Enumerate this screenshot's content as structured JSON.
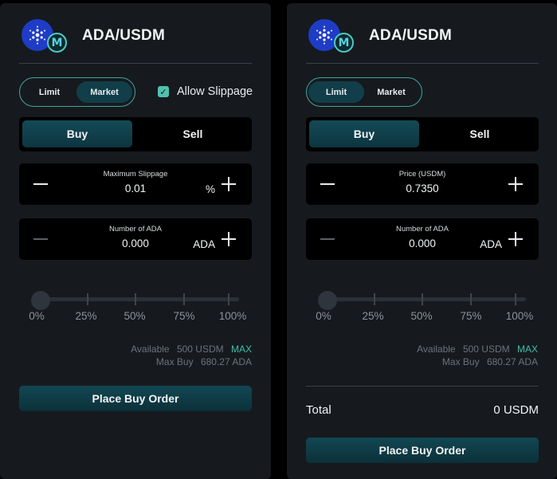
{
  "colors": {
    "accent": "#3dbfa7",
    "toggle_border": "#3ea59a",
    "buy_active": "#134a55",
    "ada_coin": "#1f3cc6"
  },
  "left_panel": {
    "header": {
      "pair": "ADA/USDM",
      "base_icon": "cardano-icon",
      "quote_icon": "usdm-icon",
      "quote_glyph": "M"
    },
    "order_type": {
      "limit_label": "Limit",
      "market_label": "Market",
      "selected": "Market"
    },
    "allow_slippage": {
      "label": "Allow Slippage",
      "checked": true,
      "check_glyph": "✓"
    },
    "side": {
      "buy_label": "Buy",
      "sell_label": "Sell",
      "selected": "Buy"
    },
    "field1": {
      "label": "Maximum Slippage",
      "value": "0.01",
      "unit": "%"
    },
    "field2": {
      "label": "Number of ADA",
      "value": "0.000",
      "unit": "ADA"
    },
    "slider": {
      "marks": [
        "0%",
        "25%",
        "50%",
        "75%",
        "100%"
      ],
      "value": 0
    },
    "available": {
      "label": "Available",
      "value": "500 USDM",
      "max_label": "MAX"
    },
    "max_buy": {
      "label": "Max Buy",
      "value": "680.27 ADA"
    },
    "submit_label": "Place Buy Order"
  },
  "right_panel": {
    "header": {
      "pair": "ADA/USDM",
      "base_icon": "cardano-icon",
      "quote_icon": "usdm-icon",
      "quote_glyph": "M"
    },
    "order_type": {
      "limit_label": "Limit",
      "market_label": "Market",
      "selected": "Limit"
    },
    "side": {
      "buy_label": "Buy",
      "sell_label": "Sell",
      "selected": "Buy"
    },
    "field1": {
      "label": "Price (USDM)",
      "value": "0.7350"
    },
    "field2": {
      "label": "Number of ADA",
      "value": "0.000",
      "unit": "ADA"
    },
    "slider": {
      "marks": [
        "0%",
        "25%",
        "50%",
        "75%",
        "100%"
      ],
      "value": 0
    },
    "available": {
      "label": "Available",
      "value": "500 USDM",
      "max_label": "MAX"
    },
    "max_buy": {
      "label": "Max Buy",
      "value": "680.27 ADA"
    },
    "total": {
      "label": "Total",
      "value": "0 USDM"
    },
    "submit_label": "Place Buy Order"
  }
}
